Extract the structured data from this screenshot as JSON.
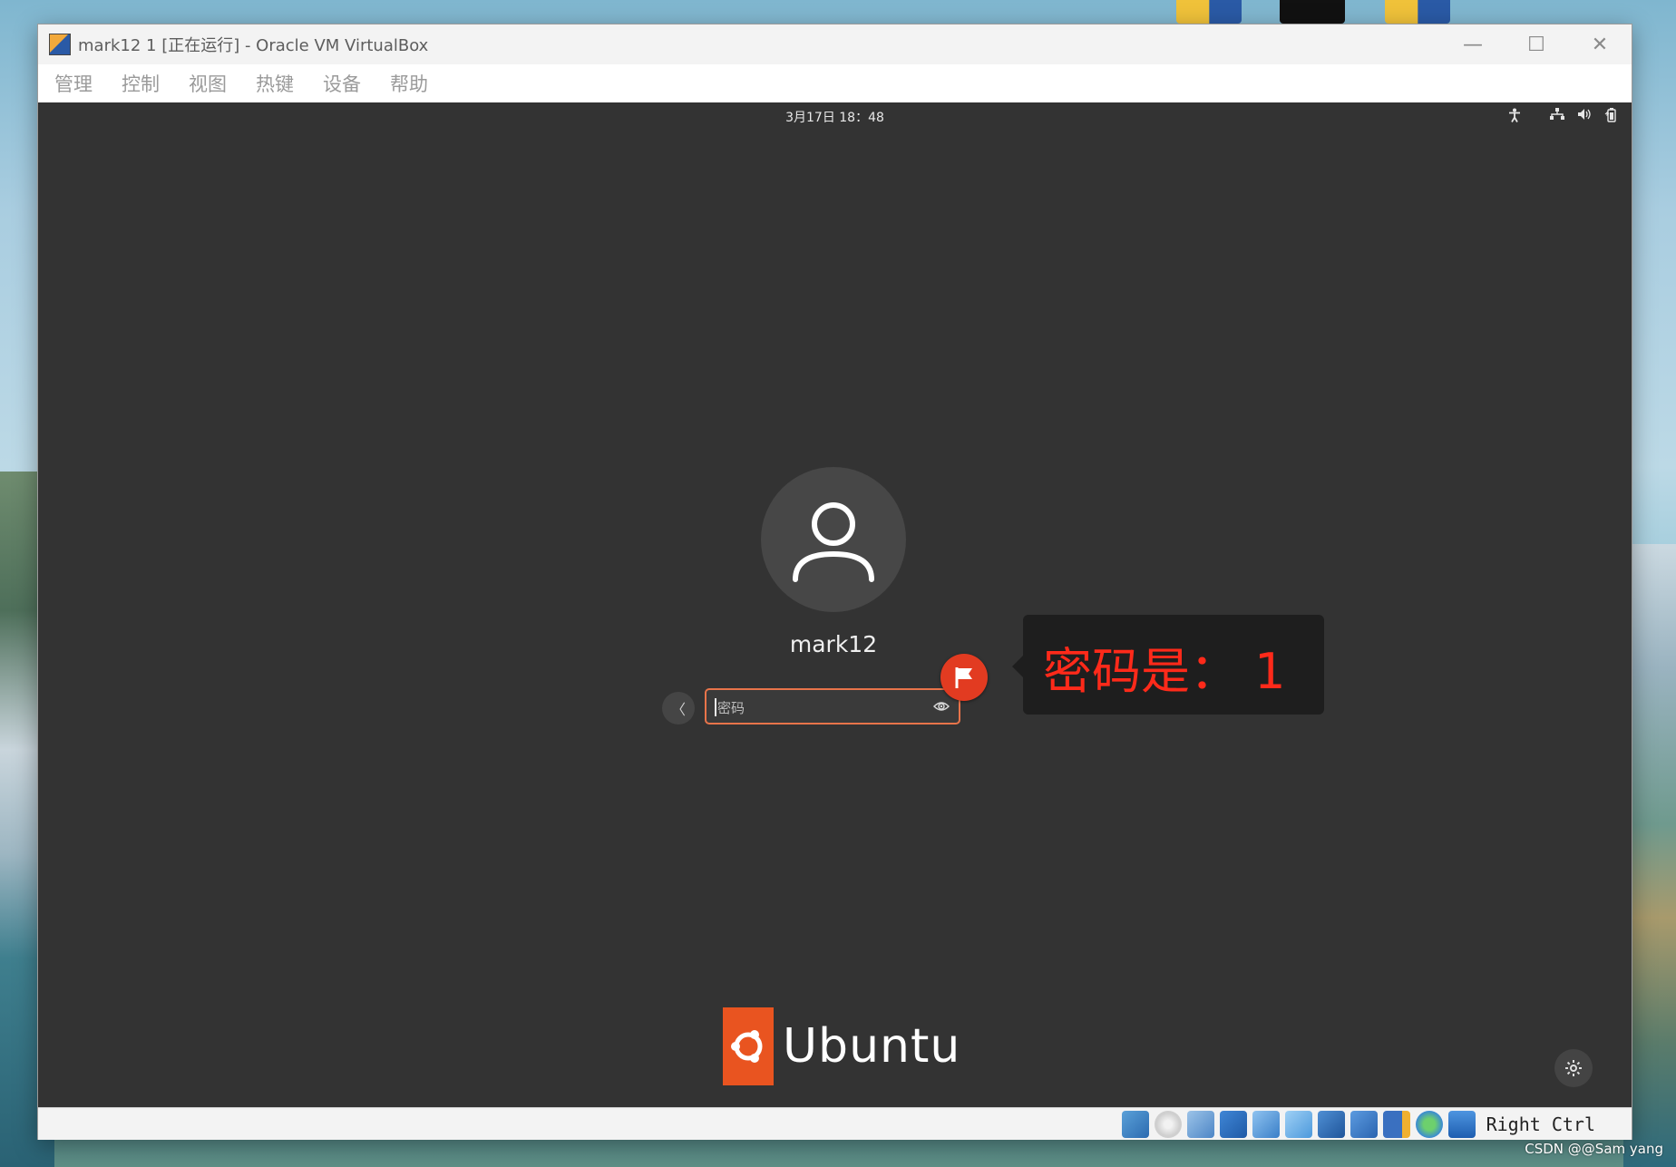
{
  "window": {
    "title": "mark12 1 [正在运行] - Oracle VM VirtualBox",
    "minimize": "—",
    "maximize": "☐",
    "close": "✕"
  },
  "menu": [
    "管理",
    "控制",
    "视图",
    "热键",
    "设备",
    "帮助"
  ],
  "vm": {
    "clock": "3月17日 18：48",
    "username": "mark12",
    "password_placeholder": "密码",
    "back_glyph": "〈",
    "tooltip_text": "密码是： 1",
    "brand": "Ubuntu"
  },
  "statusbar": {
    "host_key": "Right Ctrl"
  },
  "watermark": "CSDN @@Sam  yang",
  "colors": {
    "vm_background": "#333333",
    "accent_orange": "#e95420",
    "focus_border": "#e8744a",
    "annotation_red": "#ff2a1a"
  },
  "icons": [
    "app-icon",
    "minimize-icon",
    "maximize-icon",
    "close-icon",
    "accessibility-icon",
    "network-icon",
    "volume-icon",
    "battery-icon",
    "user-avatar-icon",
    "back-arrow-icon",
    "eye-icon",
    "flag-icon",
    "ubuntu-circle-of-friends-icon",
    "settings-gear-icon"
  ]
}
